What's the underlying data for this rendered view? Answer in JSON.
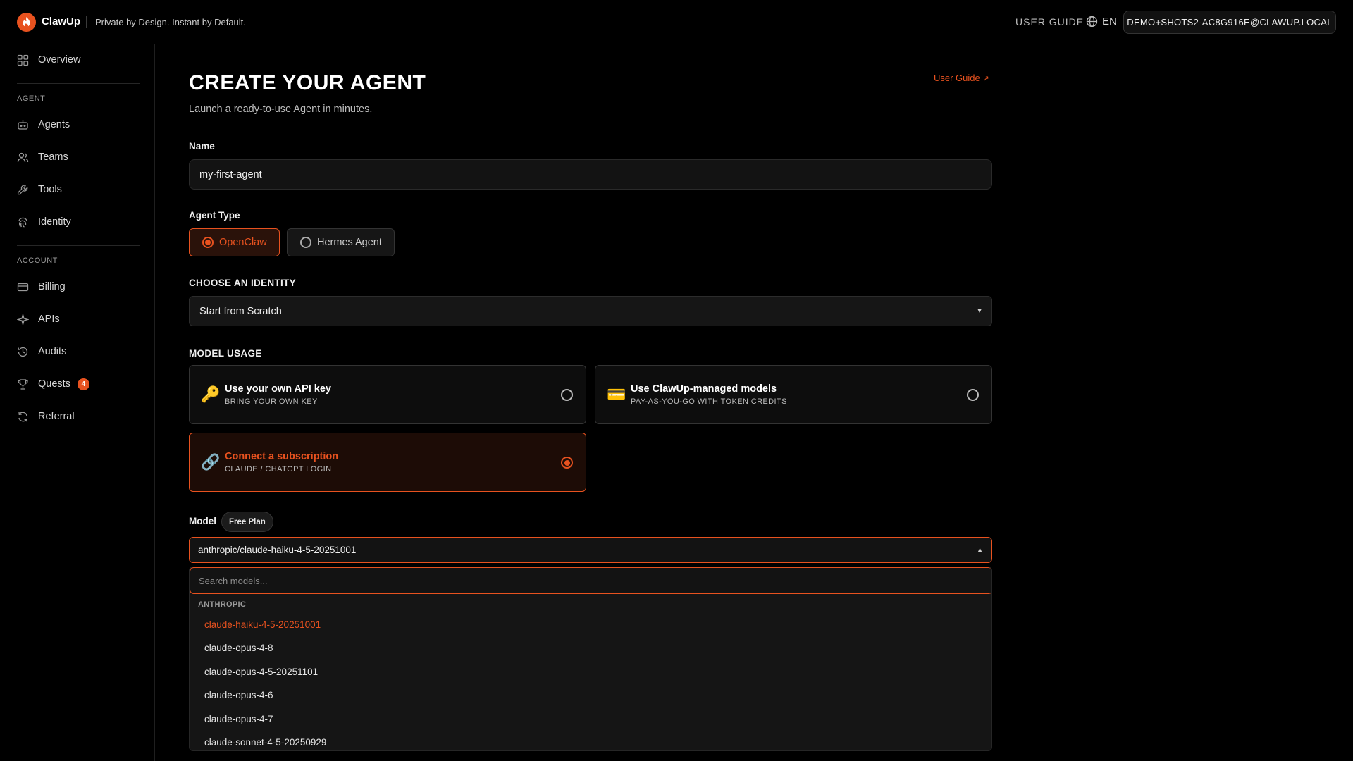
{
  "header": {
    "brand": "ClawUp",
    "tagline": "Private by Design. Instant by Default.",
    "user_guide": "USER GUIDE",
    "language": "EN",
    "account": "DEMO+SHOTS2-AC8G916E@CLAWUP.LOCAL"
  },
  "sidebar": {
    "overview": "Overview",
    "agent_section": "AGENT",
    "agents": "Agents",
    "teams": "Teams",
    "tools": "Tools",
    "identity": "Identity",
    "account_section": "ACCOUNT",
    "billing": "Billing",
    "apis": "APIs",
    "audits": "Audits",
    "quests": "Quests",
    "quests_badge": "4",
    "referral": "Referral"
  },
  "main": {
    "title": "CREATE YOUR AGENT",
    "subtitle": "Launch a ready-to-use Agent in minutes.",
    "user_guide_link": "User Guide",
    "name_label": "Name",
    "name_value": "my-first-agent",
    "agent_type_label": "Agent Type",
    "agent_types": [
      {
        "label": "OpenClaw",
        "selected": true
      },
      {
        "label": "Hermes Agent",
        "selected": false
      }
    ],
    "identity_label": "CHOOSE AN IDENTITY",
    "identity_value": "Start from Scratch",
    "model_usage_label": "MODEL USAGE",
    "usage_options": [
      {
        "icon": "key-icon",
        "title": "Use your own API key",
        "subtitle": "BRING YOUR OWN KEY",
        "selected": false
      },
      {
        "icon": "credit-card-icon",
        "title": "Use ClawUp-managed models",
        "subtitle": "PAY-AS-YOU-GO WITH TOKEN CREDITS",
        "selected": false
      },
      {
        "icon": "link-icon",
        "title": "Connect a subscription",
        "subtitle": "CLAUDE / CHATGPT LOGIN",
        "selected": true
      }
    ],
    "model_label": "Model",
    "plan_badge": "Free Plan",
    "model_value": "anthropic/claude-haiku-4-5-20251001",
    "search_placeholder": "Search models...",
    "group_label": "ANTHROPIC",
    "models": [
      "claude-haiku-4-5-20251001",
      "claude-opus-4-8",
      "claude-opus-4-5-20251101",
      "claude-opus-4-6",
      "claude-opus-4-7",
      "claude-sonnet-4-5-20250929"
    ],
    "accent_color": "#e8521f"
  }
}
